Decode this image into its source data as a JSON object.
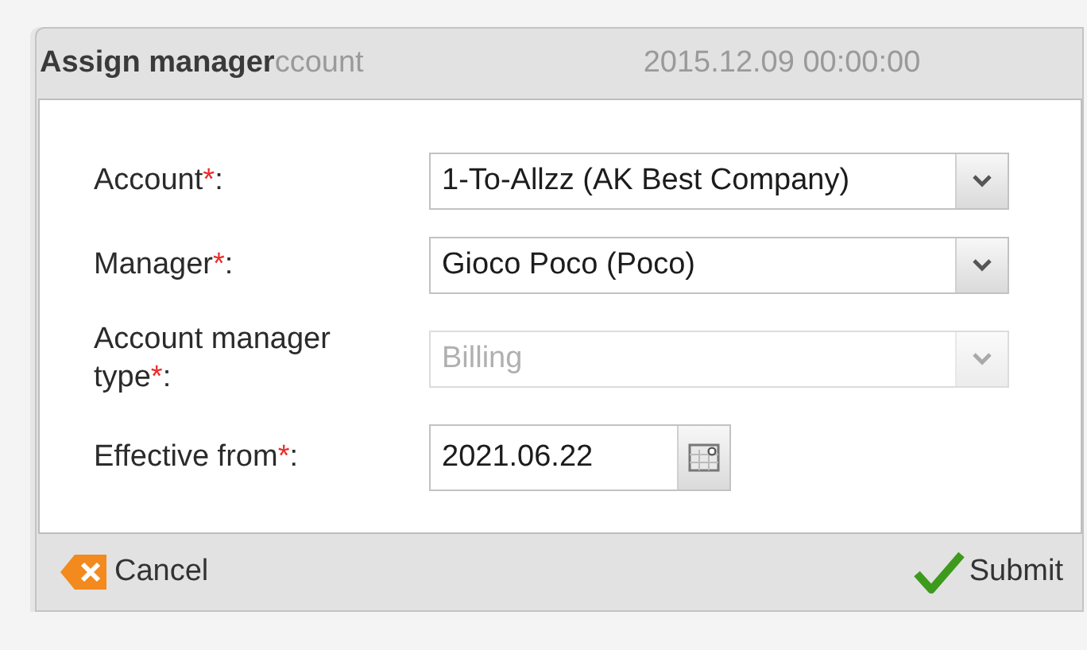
{
  "background": {
    "texts": [
      "ccount",
      "2015.12.09 00:00:00"
    ]
  },
  "dialog": {
    "title": "Assign manager",
    "fields": [
      {
        "kind": "select",
        "label": "Account",
        "required_mark": "*",
        "suffix": ":",
        "value": "1-To-Allzz (AK Best Company)",
        "disabled": false
      },
      {
        "kind": "select",
        "label": "Manager",
        "required_mark": "*",
        "suffix": ":",
        "value": "Gioco Poco (Poco)",
        "disabled": false
      },
      {
        "kind": "select",
        "label": "Account manager type",
        "required_mark": "*",
        "suffix": ":",
        "value": "Billing",
        "disabled": true
      },
      {
        "kind": "date",
        "label": "Effective from",
        "required_mark": "*",
        "suffix": ":",
        "value": "2021.06.22",
        "disabled": false
      }
    ],
    "buttons": [
      {
        "kind": "cancel",
        "label": "Cancel"
      },
      {
        "kind": "submit",
        "label": "Submit"
      }
    ]
  }
}
